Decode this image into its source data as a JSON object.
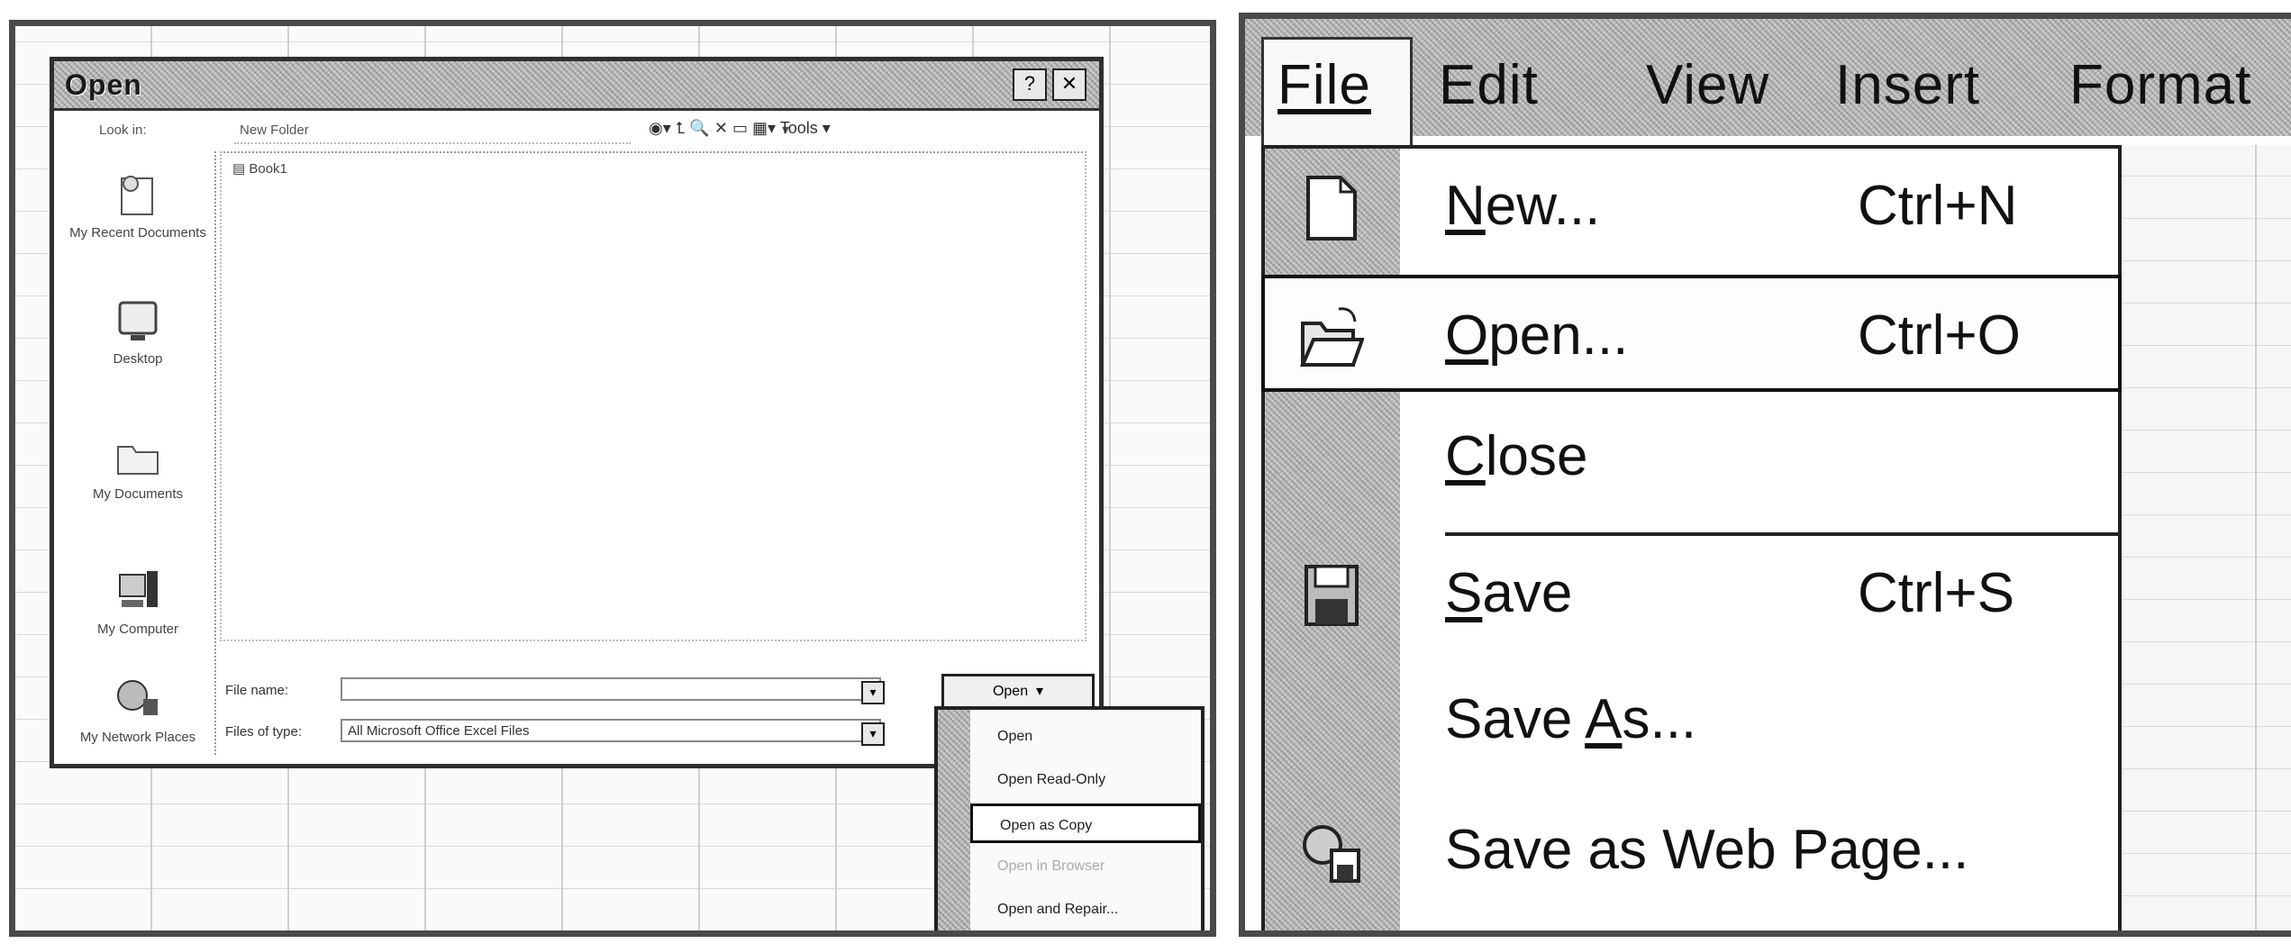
{
  "left": {
    "dialog": {
      "title": "Open",
      "look_in_label": "Look in:",
      "look_in_value": "New Folder",
      "tools_label": "Tools ▾",
      "places": [
        {
          "label": "My Recent Documents",
          "icon": "recent-documents-icon"
        },
        {
          "label": "Desktop",
          "icon": "desktop-icon"
        },
        {
          "label": "My Documents",
          "icon": "my-documents-icon"
        },
        {
          "label": "My Computer",
          "icon": "my-computer-icon"
        },
        {
          "label": "My Network Places",
          "icon": "network-places-icon"
        }
      ],
      "file_item": "Book1",
      "file_name_label": "File name:",
      "file_name_value": "",
      "files_of_type_label": "Files of type:",
      "files_of_type_value": "All Microsoft Office Excel Files",
      "open_button": "Open",
      "open_menu": [
        {
          "label": "Open",
          "state": "normal"
        },
        {
          "label": "Open Read-Only",
          "state": "normal"
        },
        {
          "label": "Open as Copy",
          "state": "highlighted"
        },
        {
          "label": "Open in Browser",
          "state": "disabled"
        },
        {
          "label": "Open and Repair...",
          "state": "normal"
        }
      ]
    }
  },
  "right": {
    "menubar": {
      "file": "File",
      "edit": "Edit",
      "view": "View",
      "insert": "Insert",
      "format": "Format"
    },
    "file_menu": {
      "new": {
        "pre": "",
        "u": "N",
        "post": "ew...",
        "shortcut": "Ctrl+N"
      },
      "open": {
        "pre": "",
        "u": "O",
        "post": "pen...",
        "shortcut": "Ctrl+O"
      },
      "close": {
        "pre": "",
        "u": "C",
        "post": "lose",
        "shortcut": ""
      },
      "save": {
        "pre": "",
        "u": "S",
        "post": "ave",
        "shortcut": "Ctrl+S"
      },
      "save_as": {
        "pre": "Save ",
        "u": "A",
        "post": "s...",
        "shortcut": ""
      },
      "save_web": {
        "pre": "Save as Web Pa",
        "u": "g",
        "post": "e...",
        "shortcut": ""
      }
    }
  }
}
